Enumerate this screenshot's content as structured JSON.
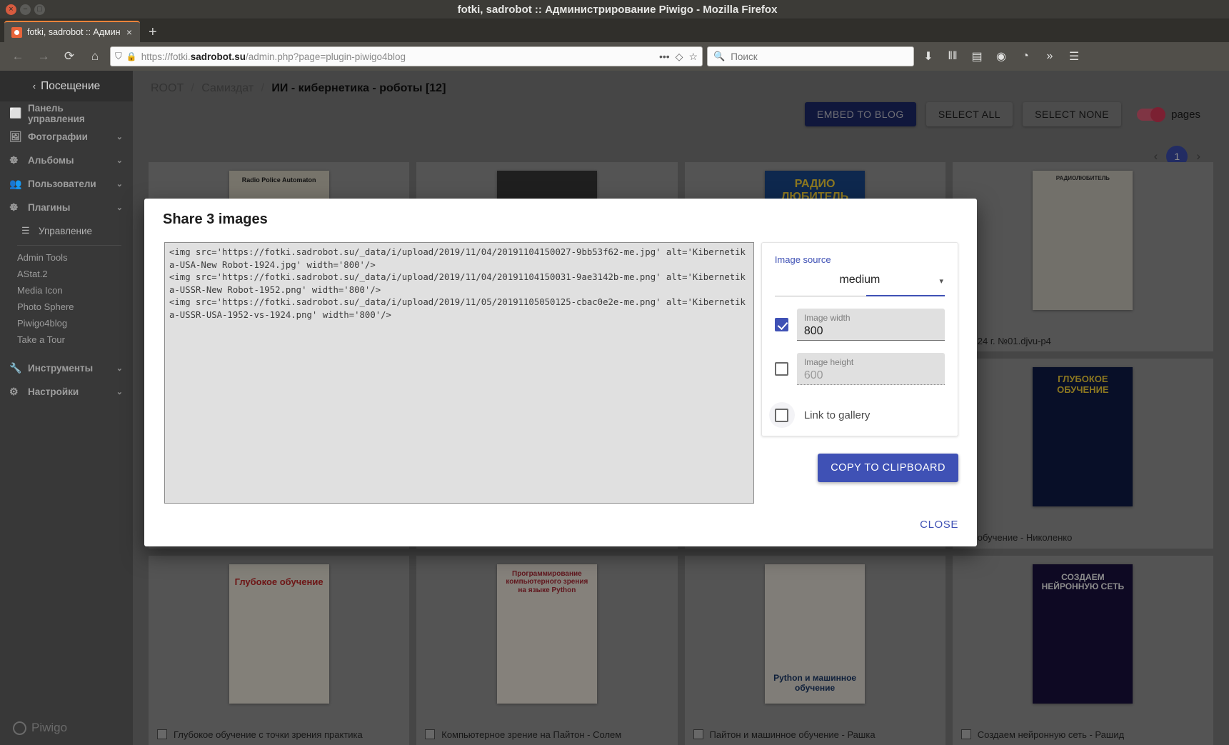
{
  "window": {
    "title": "fotki, sadrobot :: Администрирование Piwigo - Mozilla Firefox",
    "close_glyph": "×",
    "min_glyph": "−",
    "max_glyph": "□"
  },
  "browser": {
    "tab_label": "fotki, sadrobot :: Админ",
    "tab_close": "×",
    "new_tab": "+",
    "back": "←",
    "forward": "→",
    "reload": "⟳",
    "home": "⌂",
    "shield_icon": "⛉",
    "lock_icon": "🔒",
    "url_prefix": "https://fotki.",
    "url_bold": "sadrobot.su",
    "url_suffix": "/admin.php?page=plugin-piwigo4blog",
    "url_dots": "•••",
    "pocket_icon": "◇",
    "star_icon": "☆",
    "search_placeholder": "Поиск",
    "search_icon": "🔍",
    "downloads_icon": "⬇",
    "library_icon": "‖‖",
    "sidebar_icon": "▤",
    "account_icon": "◔",
    "extension_icon": "◉",
    "overflow_icon": "»",
    "menu_icon": "☰"
  },
  "sidebar": {
    "back_label": "Посещение",
    "back_chevron": "‹",
    "items": [
      {
        "label": "Панель управления",
        "icon": "⬜",
        "caret": ""
      },
      {
        "label": "Фотографии",
        "icon": "🖼",
        "caret": "⌄"
      },
      {
        "label": "Альбомы",
        "icon": "☸",
        "caret": "⌄"
      },
      {
        "label": "Пользователи",
        "icon": "👥",
        "caret": "⌄"
      },
      {
        "label": "Плагины",
        "icon": "☸",
        "caret": "⌄"
      }
    ],
    "sub_item": {
      "label": "Управление",
      "icon": "☰"
    },
    "plugins": [
      "Admin Tools",
      "AStat.2",
      "Media Icon",
      "Photo Sphere",
      "Piwigo4blog",
      "Take a Tour"
    ],
    "bottom_items": [
      {
        "label": "Инструменты",
        "icon": "🔧",
        "caret": "⌄"
      },
      {
        "label": "Настройки",
        "icon": "⚙",
        "caret": "⌄"
      }
    ],
    "logo_text": "Piwigo"
  },
  "breadcrumb": {
    "root": "ROOT",
    "parent": "Самиздат",
    "current": "ИИ - кибернетика - роботы [12]",
    "separator": "/"
  },
  "toolbar": {
    "embed_label": "EMBED TO BLOG",
    "select_all_label": "SELECT ALL",
    "select_none_label": "SELECT NONE",
    "pages_label": "pages"
  },
  "pager": {
    "prev": "‹",
    "next": "›",
    "current": "1"
  },
  "grid": [
    {
      "caption": "",
      "cover_title": "Radio Police Automaton",
      "bg": "#d9d4c4",
      "fg": "#2a2a2a"
    },
    {
      "caption": "",
      "cover_title": "",
      "bg": "#c9c6bd",
      "fg": "#1a1a1a"
    },
    {
      "caption": "",
      "cover_title": "РАДИО ЛЮБИТЕЛЬ",
      "bg": "#1b4a8f",
      "fg": "#ffd93b"
    },
    {
      "caption": "24 г. №01.djvu-p4",
      "cover_title": "РАДИОЛЮБИТЕЛЬ",
      "bg": "#cfccc2",
      "fg": "#2a2a2a"
    },
    {
      "caption": "",
      "cover_title": "",
      "bg": "#9a9a9a",
      "fg": "#2a2a2a"
    },
    {
      "caption": "",
      "cover_title": "",
      "bg": "#9a9a9a",
      "fg": "#2a2a2a"
    },
    {
      "caption": "",
      "cover_title": "",
      "bg": "#9a9a9a",
      "fg": "#2a2a2a"
    },
    {
      "caption": "обучение - Николенко",
      "cover_title": "ГЛУБОКОЕ ОБУЧЕНИЕ",
      "bg": "#0f1d4a",
      "fg": "#ffd93b"
    },
    {
      "caption": "Глубокое обучение с точки зрения практика",
      "cover_title": "Глубокое обучение",
      "bg": "#efe9dd",
      "fg": "#c62828"
    },
    {
      "caption": "Компьютерное зрение на Пайтон - Солем",
      "cover_title": "Программирование компьютерного зрения на языке Python",
      "bg": "#f2ece0",
      "fg": "#b02a37"
    },
    {
      "caption": "Пайтон и машинное обучение - Рашка",
      "cover_title": "Python и машинное обучение",
      "bg": "#e9e4da",
      "fg": "#1b3a6b"
    },
    {
      "caption": "Создаем нейронную сеть - Рашид",
      "cover_title": "СОЗДАЕМ НЕЙРОННУЮ СЕТЬ",
      "bg": "#1a1140",
      "fg": "#ffffff"
    }
  ],
  "modal": {
    "title": "Share 3 images",
    "code": "<img src='https://fotki.sadrobot.su/_data/i/upload/2019/11/04/20191104150027-9bb53f62-me.jpg' alt='Kibernetika-USA-New Robot-1924.jpg' width='800'/>\n<img src='https://fotki.sadrobot.su/_data/i/upload/2019/11/04/20191104150031-9ae3142b-me.png' alt='Kibernetika-USSR-New Robot-1952.png' width='800'/>\n<img src='https://fotki.sadrobot.su/_data/i/upload/2019/11/05/20191105050125-cbac0e2e-me.png' alt='Kibernetika-USSR-USA-1952-vs-1924.png' width='800'/>",
    "options": {
      "source_label": "Image source",
      "source_value": "medium",
      "source_caret": "▾",
      "width_label": "Image width",
      "width_value": "800",
      "width_checked": true,
      "height_label": "Image height",
      "height_value": "600",
      "height_checked": false,
      "link_label": "Link to gallery",
      "link_checked": false
    },
    "copy_label": "COPY TO CLIPBOARD",
    "close_label": "CLOSE"
  }
}
